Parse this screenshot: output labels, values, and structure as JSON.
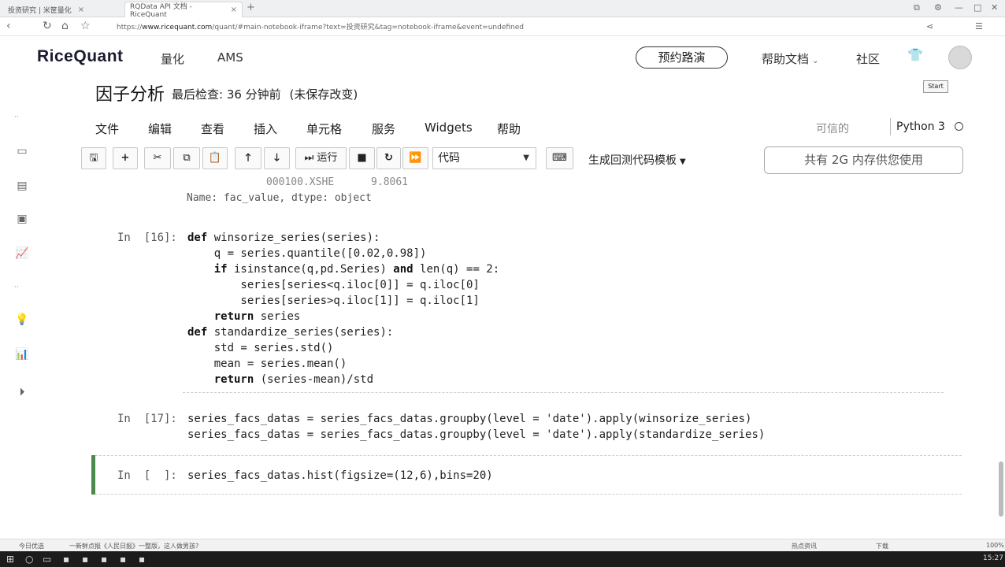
{
  "browser": {
    "tabs": [
      {
        "label": "投资研究 | 米筐量化"
      },
      {
        "label": "RQData API 文档 - RiceQuant"
      }
    ],
    "new_tab": "+",
    "url_prefix": "https://",
    "url_host": "www.ricequant.com",
    "url_rest": "/quant/#main-notebook-iframe?text=投资研究&tag=notebook-iframe&event=undefined"
  },
  "site": {
    "logo": "RiceQuant",
    "nav": [
      "量化",
      "AMS"
    ],
    "cta": "预约路演",
    "help": "帮助文档",
    "community": "社区",
    "start_label": "Start"
  },
  "notebook": {
    "title": "因子分析",
    "last_checkpoint": "最后检查: 36 分钟前",
    "unsaved": "(未保存改变)",
    "menu": [
      "文件",
      "编辑",
      "查看",
      "插入",
      "单元格",
      "服务",
      "Widgets",
      "帮助"
    ],
    "trusted": "可信的",
    "kernel": "Python 3"
  },
  "toolbar": {
    "run_label": "运行",
    "cell_type": "代码",
    "template": "生成回测代码模板",
    "memory": "共有 2G 内存供您使用"
  },
  "output": {
    "row": "000100.XSHE      9.8061",
    "name_line": "Name: fac_value, dtype: object"
  },
  "cells": [
    {
      "prompt": "In  [16]:",
      "lines": [
        "def winsorize_series(series):",
        "    q = series.quantile([0.02,0.98])",
        "    if isinstance(q,pd.Series) and len(q) == 2:",
        "        series[series<q.iloc[0]] = q.iloc[0]",
        "        series[series>q.iloc[1]] = q.iloc[1]",
        "    return series",
        "def standardize_series(series):",
        "    std = series.std()",
        "    mean = series.mean()",
        "    return (series-mean)/std"
      ]
    },
    {
      "prompt": "In  [17]:",
      "lines": [
        "series_facs_datas = series_facs_datas.groupby(level = 'date').apply(winsorize_series)",
        "series_facs_datas = series_facs_datas.groupby(level = 'date').apply(standardize_series)"
      ]
    },
    {
      "prompt": "In  [  ]:",
      "lines": [
        "series_facs_datas.hist(figsize=(12,6),bins=20)"
      ]
    }
  ],
  "statusbar": {
    "left": "今日优选",
    "news": "一新鲜点报《人民日报》一整版，这人做男孩?",
    "right": [
      "热点资讯",
      "下载",
      "100%"
    ]
  },
  "taskbar": {
    "clock": "15:27"
  }
}
